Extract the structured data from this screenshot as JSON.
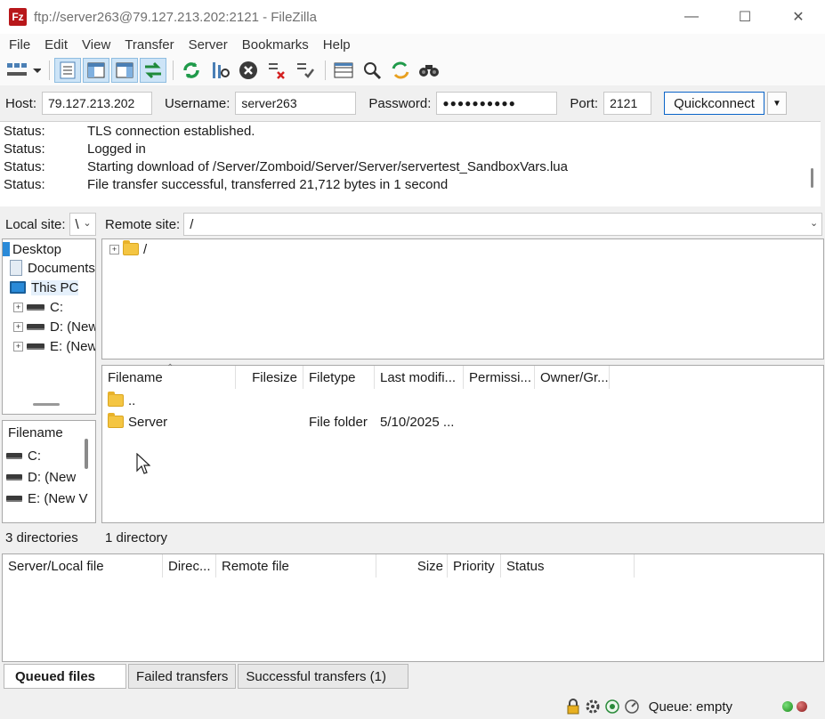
{
  "window": {
    "title": "ftp://server263@79.127.213.202:2121 - FileZilla",
    "app_icon": "Fz"
  },
  "menu": [
    "File",
    "Edit",
    "View",
    "Transfer",
    "Server",
    "Bookmarks",
    "Help"
  ],
  "quickconnect": {
    "host_label": "Host:",
    "host": "79.127.213.202",
    "user_label": "Username:",
    "user": "server263",
    "pass_label": "Password:",
    "pass": "●●●●●●●●●●",
    "port_label": "Port:",
    "port": "2121",
    "button": "Quickconnect"
  },
  "log": [
    {
      "k": "Status:",
      "v": "TLS connection established."
    },
    {
      "k": "Status:",
      "v": "Logged in"
    },
    {
      "k": "Status:",
      "v": "Starting download of /Server/Zomboid/Server/Server/servertest_SandboxVars.lua"
    },
    {
      "k": "Status:",
      "v": "File transfer successful, transferred 21,712 bytes in 1 second"
    }
  ],
  "local": {
    "site_label": "Local site:",
    "site_path": "\\",
    "tree": [
      "Desktop",
      "Documents",
      "This PC",
      "C:",
      "D: (New",
      "E: (New"
    ],
    "list_header": "Filename",
    "list": [
      "C:",
      "D: (New",
      "E: (New V"
    ],
    "status": "3 directories"
  },
  "remote": {
    "site_label": "Remote site:",
    "site_path": "/",
    "tree_root": "/",
    "columns": [
      "Filename",
      "Filesize",
      "Filetype",
      "Last modifi...",
      "Permissi...",
      "Owner/Gr..."
    ],
    "rows": [
      {
        "name": "..",
        "size": "",
        "type": "",
        "modified": ""
      },
      {
        "name": "Server",
        "size": "",
        "type": "File folder",
        "modified": "5/10/2025 ..."
      }
    ],
    "status": "1 directory"
  },
  "queue": {
    "columns": [
      "Server/Local file",
      "Direc...",
      "Remote file",
      "Size",
      "Priority",
      "Status"
    ],
    "tabs": [
      "Queued files",
      "Failed transfers",
      "Successful transfers (1)"
    ]
  },
  "statusbar": {
    "queue": "Queue: empty"
  }
}
